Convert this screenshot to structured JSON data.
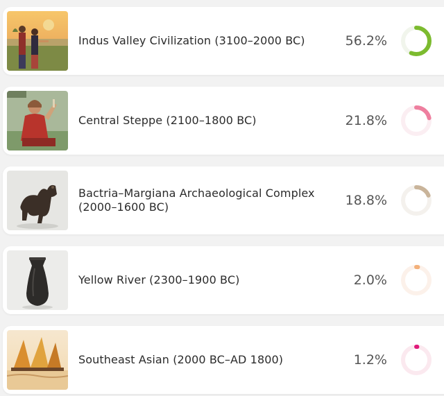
{
  "populations": [
    {
      "name": "Indus Valley Civilization (3100–2000 BC)",
      "percent_label": "56.2%",
      "percent": 56.2,
      "color": "#7cbb2f",
      "track_color": "#f1f5ec",
      "image_icon": "indus-figures-image"
    },
    {
      "name": "Central Steppe (2100–1800 BC)",
      "percent_label": "21.8%",
      "percent": 21.8,
      "color": "#ee7f9f",
      "track_color": "#fbeef2",
      "image_icon": "steppe-woman-image"
    },
    {
      "name": "Bactria–Margiana Archaeological Complex (2000–1600 BC)",
      "percent_label": "18.8%",
      "percent": 18.8,
      "color": "#c9b49a",
      "track_color": "#f4f1ed",
      "image_icon": "bronze-camel-image"
    },
    {
      "name": "Yellow River (2300–1900 BC)",
      "percent_label": "2.0%",
      "percent": 2.0,
      "color": "#f3b07a",
      "track_color": "#fcf1ea",
      "image_icon": "black-vase-image"
    },
    {
      "name": "Southeast Asian (2000 BC–AD 1800)",
      "percent_label": "1.2%",
      "percent": 1.2,
      "color": "#e0197a",
      "track_color": "#fbe9ef",
      "image_icon": "sailing-canoe-image"
    }
  ]
}
